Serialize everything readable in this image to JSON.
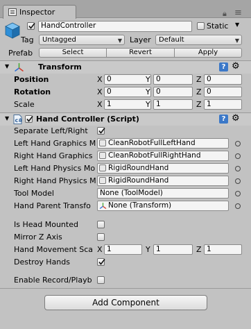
{
  "tab": {
    "label": "Inspector"
  },
  "gameobject": {
    "active": true,
    "name": "HandController",
    "static_label": "Static",
    "static_checked": false,
    "tag_label": "Tag",
    "tag_value": "Untagged",
    "layer_label": "Layer",
    "layer_value": "Default",
    "prefab_label": "Prefab",
    "prefab_buttons": [
      "Select",
      "Revert",
      "Apply"
    ]
  },
  "transform": {
    "title": "Transform",
    "rows": [
      {
        "label": "Position",
        "x": "0",
        "y": "0",
        "z": "0"
      },
      {
        "label": "Rotation",
        "x": "0",
        "y": "0",
        "z": "0"
      },
      {
        "label": "Scale",
        "x": "1",
        "y": "1",
        "z": "1"
      }
    ]
  },
  "script": {
    "enabled": true,
    "title": "Hand Controller (Script)",
    "separate_label": "Separate Left/Right",
    "separate_checked": true,
    "fields": [
      {
        "label": "Left Hand Graphics M",
        "value": "CleanRobotFullLeftHand"
      },
      {
        "label": "Right Hand Graphics",
        "value": "CleanRobotFullRightHand"
      },
      {
        "label": "Left Hand Physics Mo",
        "value": "RigidRoundHand"
      },
      {
        "label": "Right Hand Physics M",
        "value": "RigidRoundHand"
      },
      {
        "label": "Tool Model",
        "value": "None (ToolModel)"
      },
      {
        "label": "Hand Parent Transfo",
        "value": "None (Transform)"
      }
    ],
    "is_head_mounted": {
      "label": "Is Head Mounted",
      "checked": false
    },
    "mirror_z": {
      "label": "Mirror Z Axis",
      "checked": false
    },
    "hand_movement": {
      "label": "Hand Movement Sca",
      "x": "1",
      "y": "1",
      "z": "1"
    },
    "destroy_hands": {
      "label": "Destroy Hands",
      "checked": true
    },
    "enable_record": {
      "label": "Enable Record/Playb",
      "checked": false
    }
  },
  "add_component_label": "Add Component",
  "axis_labels": {
    "x": "X",
    "y": "Y",
    "z": "Z"
  },
  "colors": {
    "background": "#c2c2c2",
    "cube_icon": "#2f8fd8",
    "field_bg": "#f4f4f4"
  }
}
